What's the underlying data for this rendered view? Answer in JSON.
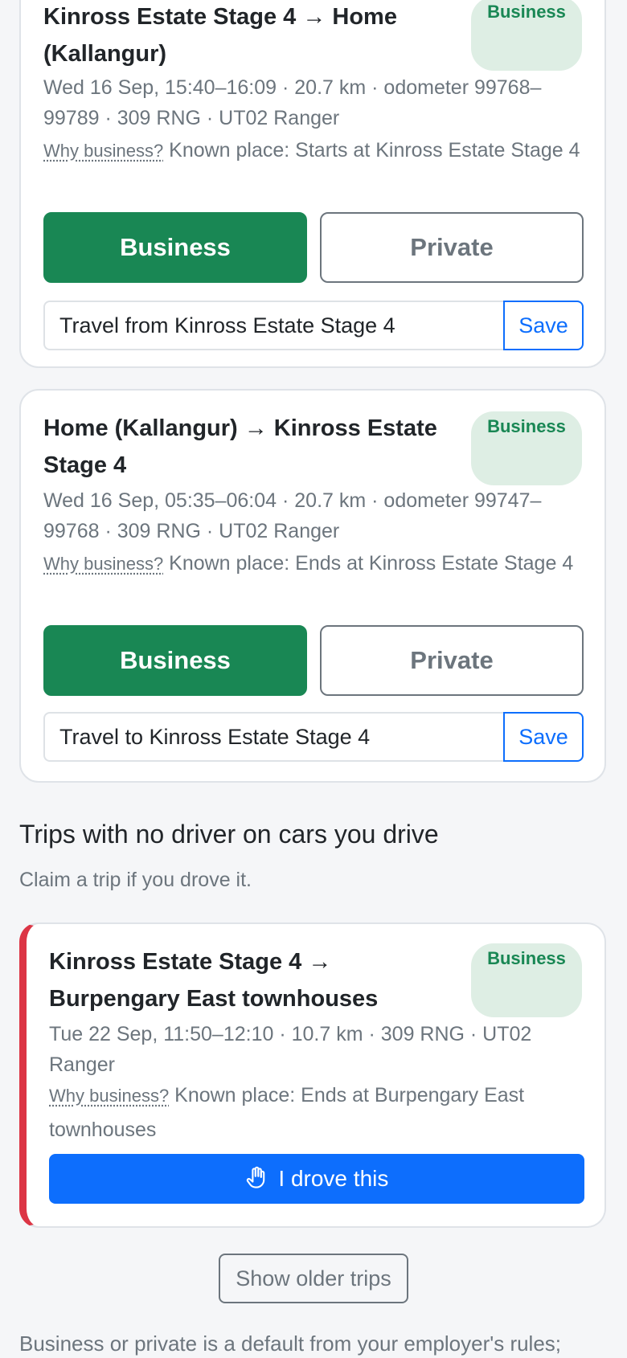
{
  "trips": [
    {
      "title": "Kinross Estate Stage 4 → Home (Kallangur)",
      "badge": "Business",
      "meta": "Wed 16 Sep, 15:40–16:09 · 20.7 km · odometer 99768–99789 · 309 RNG · UT02 Ranger",
      "why_label": "Why business?",
      "why_text": "Known place: Starts at Kinross Estate Stage 4",
      "business_label": "Business",
      "private_label": "Private",
      "note_value": "Travel from Kinross Estate Stage 4",
      "save_label": "Save"
    },
    {
      "title": "Home (Kallangur) → Kinross Estate Stage 4",
      "badge": "Business",
      "meta": "Wed 16 Sep, 05:35–06:04 · 20.7 km · odometer 99747–99768 · 309 RNG · UT02 Ranger",
      "why_label": "Why business?",
      "why_text": "Known place: Ends at Kinross Estate Stage 4",
      "business_label": "Business",
      "private_label": "Private",
      "note_value": "Travel to Kinross Estate Stage 4",
      "save_label": "Save"
    }
  ],
  "unclaimed_section": {
    "title": "Trips with no driver on cars you drive",
    "subtitle": "Claim a trip if you drove it.",
    "trip": {
      "title": "Kinross Estate Stage 4 → Burpengary East townhouses",
      "badge": "Business",
      "meta": "Tue 22 Sep, 11:50–12:10 · 10.7 km · 309 RNG · UT02 Ranger",
      "why_label": "Why business?",
      "why_text": "Known place: Ends at Burpengary East townhouses",
      "claim_label": "I drove this",
      "claim_icon": "hand-icon"
    }
  },
  "show_older_label": "Show older trips",
  "footer_note": "Business or private is a default from your employer's rules;",
  "colors": {
    "business_green": "#198754",
    "badge_bg": "#deeee4",
    "primary_blue": "#0d6efd",
    "unclaimed_red": "#dc3545",
    "muted": "#6c757d"
  }
}
